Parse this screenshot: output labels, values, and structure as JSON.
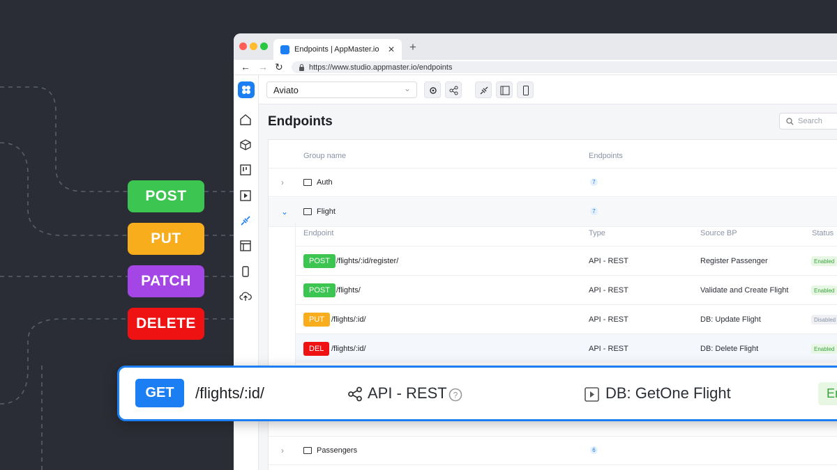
{
  "methods": [
    {
      "label": "POST",
      "color": "#3cc551"
    },
    {
      "label": "PUT",
      "color": "#f8ad1c"
    },
    {
      "label": "PATCH",
      "color": "#a445e6"
    },
    {
      "label": "DELETE",
      "color": "#ef1212"
    }
  ],
  "browser": {
    "tab_title": "Endpoints | AppMaster.io",
    "url": "https://www.studio.appmaster.io/endpoints"
  },
  "topbar": {
    "project": "Aviato"
  },
  "page": {
    "title": "Endpoints",
    "search_placeholder": "Search"
  },
  "table": {
    "headers": {
      "group": "Group name",
      "endpoints": "Endpoints"
    },
    "groups": [
      {
        "name": "Auth",
        "count": "7"
      },
      {
        "name": "Flight",
        "count": "7"
      },
      {
        "name": "Passengers",
        "count": "6"
      }
    ],
    "sub_headers": {
      "endpoint": "Endpoint",
      "type": "Type",
      "source": "Source BP",
      "status": "Status"
    },
    "endpoints": [
      {
        "method": "POST",
        "color": "#3cc551",
        "path": "/flights/:id/register/",
        "type": "API - REST",
        "source": "Register Passenger",
        "status": "Enabled"
      },
      {
        "method": "POST",
        "color": "#3cc551",
        "path": "/flights/",
        "type": "API - REST",
        "source": "Validate and Create Flight",
        "status": "Enabled"
      },
      {
        "method": "PUT",
        "color": "#f8ad1c",
        "path": "/flights/:id/",
        "type": "API - REST",
        "source": "DB: Update Flight",
        "status": "Disabled"
      },
      {
        "method": "DEL",
        "color": "#ef1212",
        "path": "/flights/:id/",
        "type": "API - REST",
        "source": "DB: Delete Flight",
        "status": "Enabled"
      }
    ]
  },
  "highlight": {
    "method": "GET",
    "path": "/flights/:id/",
    "type": "API - REST",
    "source": "DB: GetOne Flight",
    "status": "En"
  }
}
